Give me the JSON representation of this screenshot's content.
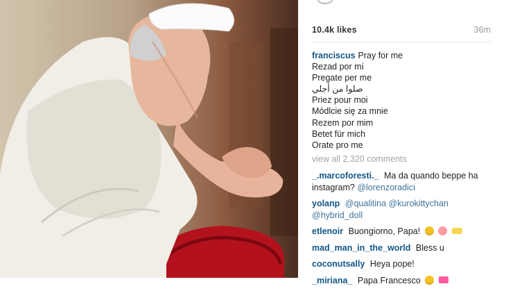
{
  "post": {
    "likes": "10.4k likes",
    "time_ago": "36m"
  },
  "caption": {
    "username": "franciscus",
    "lines": [
      "Pray for me",
      "Rezad por mí",
      "Pregate per me",
      "صلوا من أجلي",
      "Priez pour moi",
      "Módlcie się za mnie",
      "Rezem por mim",
      "Betet für mich",
      "Orate pro me"
    ]
  },
  "view_all_comments": "view all 2,320 comments",
  "comments": [
    {
      "user": "_.marcoforesti._",
      "text": "Ma da quando beppe ha instagram?",
      "mention": "@lorenzoradici"
    },
    {
      "user": "yolanp",
      "mention1": "@qualitina",
      "mention2": "@kurokittychan",
      "mention3": "@hybrid_doll"
    },
    {
      "user": "etlenoir",
      "text": "Buongiorno, Papa!"
    },
    {
      "user": "mad_man_in_the_world",
      "text": "Bless u"
    },
    {
      "user": "coconutsally",
      "text": "Heya pope!"
    },
    {
      "user": "_miriana_",
      "text": "Papa Francesco"
    }
  ],
  "colors": {
    "username": "#125688",
    "mention": "#3f729b",
    "muted": "#9a9a9a"
  },
  "icons": [
    "smile-emoji-icon",
    "baby-emoji-icon",
    "clapping-hands-emoji-icon",
    "ribbon-emoji-icon"
  ]
}
